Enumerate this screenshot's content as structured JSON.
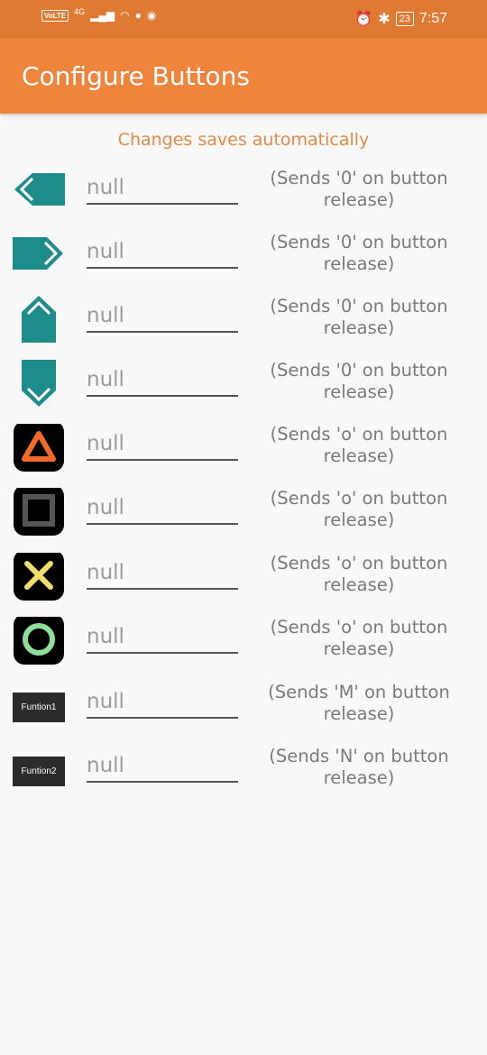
{
  "status": {
    "network": "4G",
    "volte": "VoLTE",
    "battery": "23",
    "time": "7:57"
  },
  "appbar": {
    "title": "Configure Buttons"
  },
  "subtitle": "Changes saves automatically",
  "colors": {
    "accent": "#ef843c",
    "teal": "#1f8c8c"
  },
  "rows": [
    {
      "icon": "arrow-left-icon",
      "value": "null",
      "note": "(Sends '0' on button release)"
    },
    {
      "icon": "arrow-right-icon",
      "value": "null",
      "note": "(Sends '0' on button release)"
    },
    {
      "icon": "arrow-up-icon",
      "value": "null",
      "note": "(Sends '0' on button release)"
    },
    {
      "icon": "arrow-down-icon",
      "value": "null",
      "note": "(Sends '0' on button release)"
    },
    {
      "icon": "triangle-icon",
      "value": "null",
      "note": "(Sends 'o' on button release)"
    },
    {
      "icon": "square-icon",
      "value": "null",
      "note": "(Sends 'o' on button release)"
    },
    {
      "icon": "cross-icon",
      "value": "null",
      "note": "(Sends 'o' on button release)"
    },
    {
      "icon": "circle-icon",
      "value": "null",
      "note": "(Sends 'o' on button release)"
    },
    {
      "icon": "function1-button",
      "label": "Funtion1",
      "value": "null",
      "note": "(Sends 'M' on button release)"
    },
    {
      "icon": "function2-button",
      "label": "Funtion2",
      "value": "null",
      "note": "(Sends 'N' on button release)"
    }
  ]
}
